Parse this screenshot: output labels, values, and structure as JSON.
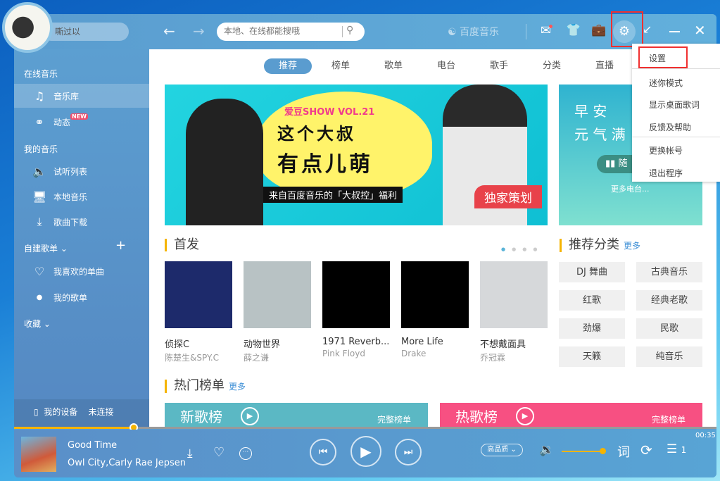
{
  "user": {
    "name": "嘶过以"
  },
  "search": {
    "placeholder": "本地、在线都能搜哦"
  },
  "brand": "百度音乐",
  "nav_tabs": [
    "推荐",
    "榜单",
    "歌单",
    "电台",
    "歌手",
    "分类",
    "直播"
  ],
  "sidebar": {
    "online_header": "在线音乐",
    "library": "音乐库",
    "feed": "动态",
    "new_badge": "NEW",
    "my_header": "我的音乐",
    "trial": "试听列表",
    "local": "本地音乐",
    "download": "歌曲下载",
    "custom_header": "自建歌单",
    "liked": "我喜欢的单曲",
    "my_list": "我的歌单",
    "collect_header": "收藏",
    "device": "我的设备",
    "device_status": "未连接"
  },
  "banner": {
    "series": "爱豆SHOW VOL.21",
    "headline1": "这个大叔",
    "headline2": "有点儿萌",
    "sub": "来自百度音乐的「大叔控」福利",
    "tag": "独家策划"
  },
  "side_banner": {
    "line1": "早 安",
    "line2": "元 气 满",
    "btn": "随",
    "more": "更多电台..."
  },
  "first_release": {
    "title": "首发",
    "albums": [
      {
        "title": "侦探C",
        "artist": "陈楚生&SPY.C",
        "color": "#1d2a6b"
      },
      {
        "title": "动物世界",
        "artist": "薛之谦",
        "color": "#b8c2c4"
      },
      {
        "title": "1971 Reverb...",
        "artist": "Pink Floyd",
        "color": "#000000"
      },
      {
        "title": "More Life",
        "artist": "Drake",
        "color": "#000000"
      },
      {
        "title": "不想戴面具",
        "artist": "乔冠霖",
        "color": "#d6d8da"
      }
    ]
  },
  "categories": {
    "title": "推荐分类",
    "more": "更多",
    "items": [
      "DJ 舞曲",
      "古典音乐",
      "红歌",
      "经典老歌",
      "劲爆",
      "民歌",
      "天籁",
      "纯音乐"
    ]
  },
  "hot_charts": {
    "title": "热门榜单",
    "more": "更多",
    "cards": [
      {
        "name": "新歌榜",
        "link": "完整榜单",
        "color": "#5bb8c4"
      },
      {
        "name": "热歌榜",
        "link": "完整榜单",
        "color": "#f75082"
      }
    ]
  },
  "menu": {
    "items": [
      "设置",
      "迷你模式",
      "显示桌面歌词",
      "反馈及帮助",
      "更换帐号",
      "退出程序"
    ]
  },
  "player": {
    "title": "Good Time",
    "artist": "Owl City,Carly Rae Jepsen",
    "time": "00:35",
    "quality": "高品质",
    "lyrics": "词",
    "queue_count": "1",
    "progress_percent": 17,
    "volume_percent": 100
  },
  "colors": {
    "accent": "#f5b400",
    "topbar": "#5a9ccf",
    "highlight": "#f03030"
  }
}
